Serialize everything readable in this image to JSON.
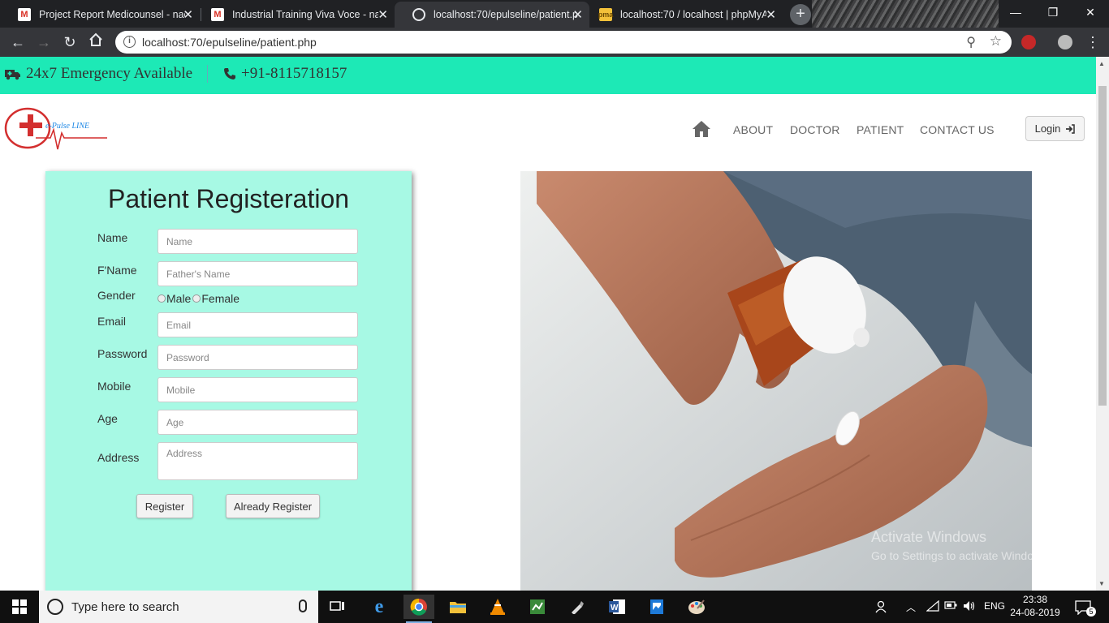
{
  "browser": {
    "tabs": [
      {
        "title": "Project Report Medicounsel - nac",
        "icon": "gmail-icon",
        "active": false
      },
      {
        "title": "Industrial Training Viva Voce - na",
        "icon": "gmail-icon",
        "active": false
      },
      {
        "title": "localhost:70/epulseline/patient.p",
        "icon": "globe-icon",
        "active": true
      },
      {
        "title": "localhost:70 / localhost | phpMyA",
        "icon": "phpmyadmin-icon",
        "active": false
      }
    ],
    "new_tab_label": "+",
    "url": "localhost:70/epulseline/patient.php",
    "window_controls": {
      "minimize": "—",
      "restore": "❐",
      "close": "✕"
    }
  },
  "topbar": {
    "emergency": "24x7 Emergency Available",
    "phone": "+91-8115718157",
    "bg_color": "#1de9b6"
  },
  "logo": {
    "text": "e-Pulse LINE"
  },
  "nav": {
    "items": [
      "ABOUT",
      "DOCTOR",
      "PATIENT",
      "CONTACT US"
    ],
    "login": "Login"
  },
  "form": {
    "title": "Patient Registeration",
    "bg_color": "#a7f9e4",
    "fields": {
      "name": {
        "label": "Name",
        "placeholder": "Name"
      },
      "fname": {
        "label": "F'Name",
        "placeholder": "Father's Name"
      },
      "gender": {
        "label": "Gender",
        "options": [
          "Male",
          "Female"
        ]
      },
      "email": {
        "label": "Email",
        "placeholder": "Email"
      },
      "password": {
        "label": "Password",
        "placeholder": "Password"
      },
      "mobile": {
        "label": "Mobile",
        "placeholder": "Mobile"
      },
      "age": {
        "label": "Age",
        "placeholder": "Age"
      },
      "address": {
        "label": "Address",
        "placeholder": "Address"
      }
    },
    "buttons": {
      "register": "Register",
      "already": "Already Register"
    }
  },
  "watermark": {
    "line1": "Activate Windows",
    "line2": "Go to Settings to activate Windows."
  },
  "taskbar": {
    "search_placeholder": "Type here to search",
    "lang": "ENG",
    "time": "23:38",
    "date": "24-08-2019",
    "notification_count": "5"
  }
}
